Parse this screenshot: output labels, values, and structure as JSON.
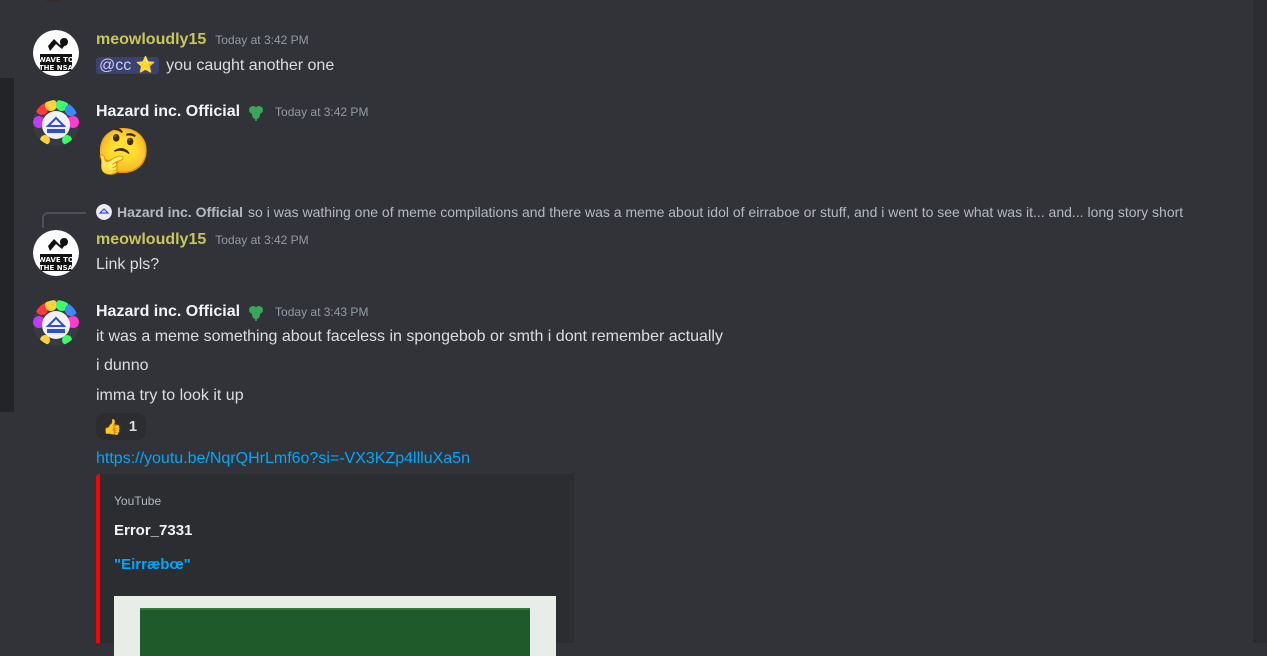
{
  "messages": [
    {
      "username": "meowloudly15",
      "timestamp": "Today at 3:42 PM",
      "avatar_text": "WAVE TO THE NSA",
      "mention": "@cc",
      "mention_emoji": "⭐",
      "text": "you caught another one"
    },
    {
      "username": "Hazard inc. Official",
      "timestamp": "Today at 3:42 PM",
      "emoji": "🤔"
    },
    {
      "reply_to_name": "Hazard inc. Official",
      "reply_text": "so i was wathing one of meme compilations and there was a meme about idol of eirraboe or stuff, and i went to see what was it... and... long story short",
      "username": "meowloudly15",
      "timestamp": "Today at 3:42 PM",
      "text": "Link pls?"
    },
    {
      "username": "Hazard inc. Official",
      "timestamp": "Today at 3:43 PM",
      "lines": [
        "it was a meme something about faceless in spongebob or smth i dont remember actually",
        "i dunno",
        "imma try to look it up"
      ],
      "reaction_emoji": "👍",
      "reaction_count": "1",
      "link": "https://youtu.be/NqrQHrLmf6o?si=-VX3KZp4llluXa5n"
    }
  ],
  "embed": {
    "provider": "YouTube",
    "author": "Error_7331",
    "title": "\"Eirræbœ\""
  },
  "colors": {
    "background": "#313338",
    "username_yellow": "#c7c85a",
    "link": "#00a8fc",
    "embed_border": "#ff0000",
    "mention_bg": "#3c4270"
  },
  "icons": {
    "role_icon": "shamrock-icon"
  }
}
